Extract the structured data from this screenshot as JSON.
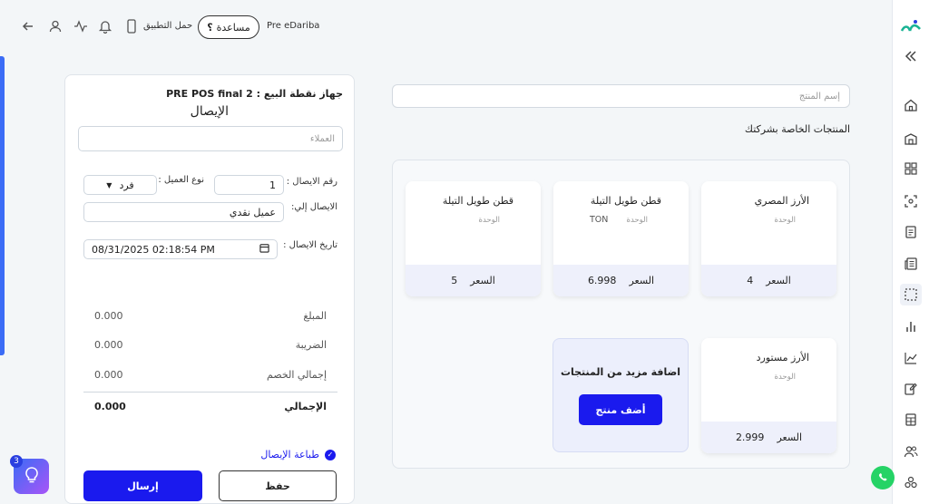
{
  "topbar": {
    "brand": "Pre eDariba",
    "help_label": "مساعدة",
    "download_label": "حمل التطبيق"
  },
  "receipt": {
    "device_title": "جهاز نقطة البيع : PRE POS final 2",
    "receipt_title": "الإيصال",
    "customers_placeholder": "العملاء",
    "receipt_no_label": "رقم الايصال :",
    "receipt_no_value": "1",
    "customer_type_label": "نوع العميل :",
    "customer_type_value": "فرد",
    "receipt_to_label": "الايصال إلي:",
    "receipt_to_value": "عميل نقدي",
    "date_label": "تاريخ الايصال :",
    "date_value": "08/31/2025 02:18:54 PM",
    "summary": [
      {
        "label": "المبلغ",
        "value": "0.000"
      },
      {
        "label": "الضريبة",
        "value": "0.000"
      },
      {
        "label": "إجمالي الخصم",
        "value": "0.000"
      }
    ],
    "total_label": "الإجمالي",
    "total_value": "0.000",
    "print_label": "طباعة الإيصال",
    "save_label": "حفظ",
    "send_label": "إرسال"
  },
  "products": {
    "search_placeholder": "إسم المنتج",
    "section_title": "المنتجات الخاصة بشركتك",
    "unit_label": "الوحدة",
    "price_label": "السعر",
    "items": [
      {
        "name": "الأرز المصري",
        "unit": "",
        "price": "4"
      },
      {
        "name": "قطن طويل التيلة",
        "unit": "TON",
        "price": "6.998"
      },
      {
        "name": "قطن طويل التيلة",
        "unit": "",
        "price": "5"
      },
      {
        "name": "الأرز مستورد",
        "unit": "",
        "price": "2.999"
      }
    ],
    "add_more_label": "اضافة مزيد من المنتجات",
    "add_product_label": "أضف منتج"
  },
  "hint_badge": "3",
  "colors": {
    "accent": "#1a1aee",
    "brand_green": "#19b394",
    "brand_blue": "#2a3fe0",
    "whatsapp": "#25d366"
  }
}
